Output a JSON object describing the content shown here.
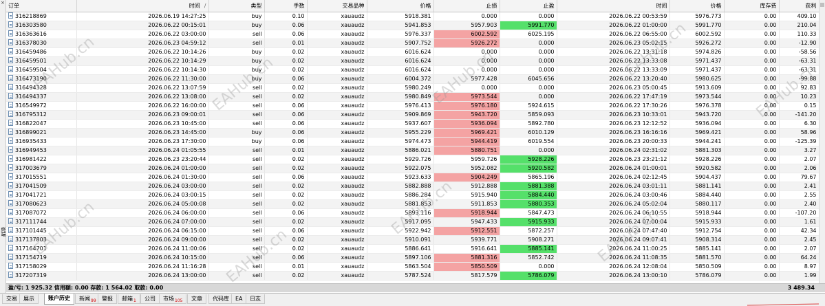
{
  "columns": [
    {
      "key": "order",
      "label": "订单"
    },
    {
      "key": "open_time",
      "label": "时间"
    },
    {
      "key": "type",
      "label": "类型"
    },
    {
      "key": "lots",
      "label": "手数"
    },
    {
      "key": "symbol",
      "label": "交易品种"
    },
    {
      "key": "open_price",
      "label": "价格"
    },
    {
      "key": "sl",
      "label": "止损"
    },
    {
      "key": "tp",
      "label": "止盈"
    },
    {
      "key": "close_time",
      "label": "时间"
    },
    {
      "key": "close_price",
      "label": "价格"
    },
    {
      "key": "swap",
      "label": "库存费"
    },
    {
      "key": "profit",
      "label": "获利"
    }
  ],
  "sort_indicator": "/",
  "rows": [
    {
      "order": "316218869",
      "open_time": "2026.06.19 14:27:25",
      "type": "buy",
      "lots": "0.10",
      "symbol": "xauaudz",
      "open_price": "5918.381",
      "sl": "0.000",
      "tp": "0.000",
      "close_time": "2026.06.22 00:53:59",
      "close_price": "5976.773",
      "swap": "0.00",
      "profit": "409.10",
      "sl_hl": "",
      "tp_hl": ""
    },
    {
      "order": "316303580",
      "open_time": "2026.06.22 00:15:01",
      "type": "buy",
      "lots": "0.06",
      "symbol": "xauaudz",
      "open_price": "5941.853",
      "sl": "5957.903",
      "tp": "5991.770",
      "close_time": "2026.06.22 01:00:00",
      "close_price": "5991.770",
      "swap": "0.00",
      "profit": "210.04",
      "sl_hl": "",
      "tp_hl": "green"
    },
    {
      "order": "316363616",
      "open_time": "2026.06.22 03:00:00",
      "type": "sell",
      "lots": "0.06",
      "symbol": "xauaudz",
      "open_price": "5976.337",
      "sl": "6002.592",
      "tp": "6025.195",
      "close_time": "2026.06.22 06:55:00",
      "close_price": "6002.592",
      "swap": "0.00",
      "profit": "110.33",
      "sl_hl": "red",
      "tp_hl": ""
    },
    {
      "order": "316378030",
      "open_time": "2026.06.23 04:59:12",
      "type": "sell",
      "lots": "0.01",
      "symbol": "xauaudz",
      "open_price": "5907.752",
      "sl": "5926.272",
      "tp": "0.000",
      "close_time": "2026.06.23 05:02:15",
      "close_price": "5926.272",
      "swap": "0.00",
      "profit": "-12.90",
      "sl_hl": "red",
      "tp_hl": ""
    },
    {
      "order": "316459486",
      "open_time": "2026.06.22 10:14:26",
      "type": "buy",
      "lots": "0.02",
      "symbol": "xauaudz",
      "open_price": "6016.624",
      "sl": "0.000",
      "tp": "0.000",
      "close_time": "2026.06.22 13:31:18",
      "close_price": "5974.826",
      "swap": "0.00",
      "profit": "-58.56",
      "sl_hl": "",
      "tp_hl": ""
    },
    {
      "order": "316459501",
      "open_time": "2026.06.22 10:14:29",
      "type": "buy",
      "lots": "0.02",
      "symbol": "xauaudz",
      "open_price": "6016.624",
      "sl": "0.000",
      "tp": "0.000",
      "close_time": "2026.06.22 13:33:08",
      "close_price": "5971.437",
      "swap": "0.00",
      "profit": "-63.31",
      "sl_hl": "",
      "tp_hl": ""
    },
    {
      "order": "316459504",
      "open_time": "2026.06.22 10:14:30",
      "type": "buy",
      "lots": "0.02",
      "symbol": "xauaudz",
      "open_price": "6016.624",
      "sl": "0.000",
      "tp": "0.000",
      "close_time": "2026.06.22 13:33:09",
      "close_price": "5971.437",
      "swap": "0.00",
      "profit": "-63.31",
      "sl_hl": "",
      "tp_hl": ""
    },
    {
      "order": "316473190",
      "open_time": "2026.06.22 11:30:00",
      "type": "buy",
      "lots": "0.06",
      "symbol": "xauaudz",
      "open_price": "6004.372",
      "sl": "5977.428",
      "tp": "6045.656",
      "close_time": "2026.06.22 13:20:40",
      "close_price": "5980.625",
      "swap": "0.00",
      "profit": "-99.88",
      "sl_hl": "",
      "tp_hl": ""
    },
    {
      "order": "316494328",
      "open_time": "2026.06.22 13:07:59",
      "type": "sell",
      "lots": "0.02",
      "symbol": "xauaudz",
      "open_price": "5980.249",
      "sl": "0.000",
      "tp": "0.000",
      "close_time": "2026.06.23 05:00:45",
      "close_price": "5913.609",
      "swap": "0.00",
      "profit": "92.83",
      "sl_hl": "",
      "tp_hl": ""
    },
    {
      "order": "316494337",
      "open_time": "2026.06.22 13:08:00",
      "type": "sell",
      "lots": "0.02",
      "symbol": "xauaudz",
      "open_price": "5980.849",
      "sl": "5973.544",
      "tp": "0.000",
      "close_time": "2026.06.22 17:47:19",
      "close_price": "5973.544",
      "swap": "0.00",
      "profit": "10.23",
      "sl_hl": "red",
      "tp_hl": ""
    },
    {
      "order": "316549972",
      "open_time": "2026.06.22 16:00:00",
      "type": "sell",
      "lots": "0.06",
      "symbol": "xauaudz",
      "open_price": "5976.413",
      "sl": "5976.180",
      "tp": "5924.615",
      "close_time": "2026.06.22 17:30:26",
      "close_price": "5976.378",
      "swap": "0.00",
      "profit": "0.15",
      "sl_hl": "red",
      "tp_hl": ""
    },
    {
      "order": "316795312",
      "open_time": "2026.06.23 09:00:01",
      "type": "sell",
      "lots": "0.06",
      "symbol": "xauaudz",
      "open_price": "5909.869",
      "sl": "5943.720",
      "tp": "5859.093",
      "close_time": "2026.06.23 10:33:01",
      "close_price": "5943.720",
      "swap": "0.00",
      "profit": "-141.20",
      "sl_hl": "red",
      "tp_hl": ""
    },
    {
      "order": "316822047",
      "open_time": "2026.06.23 10:45:00",
      "type": "sell",
      "lots": "0.06",
      "symbol": "xauaudz",
      "open_price": "5937.607",
      "sl": "5936.094",
      "tp": "5892.780",
      "close_time": "2026.06.23 12:12:52",
      "close_price": "5936.094",
      "swap": "0.00",
      "profit": "6.30",
      "sl_hl": "red",
      "tp_hl": ""
    },
    {
      "order": "316899021",
      "open_time": "2026.06.23 14:45:00",
      "type": "buy",
      "lots": "0.06",
      "symbol": "xauaudz",
      "open_price": "5955.229",
      "sl": "5969.421",
      "tp": "6010.129",
      "close_time": "2026.06.23 16:16:16",
      "close_price": "5969.421",
      "swap": "0.00",
      "profit": "58.96",
      "sl_hl": "red",
      "tp_hl": ""
    },
    {
      "order": "316935433",
      "open_time": "2026.06.23 17:30:00",
      "type": "buy",
      "lots": "0.06",
      "symbol": "xauaudz",
      "open_price": "5974.473",
      "sl": "5944.419",
      "tp": "6019.554",
      "close_time": "2026.06.23 20:00:33",
      "close_price": "5944.241",
      "swap": "0.00",
      "profit": "-125.39",
      "sl_hl": "red",
      "tp_hl": ""
    },
    {
      "order": "316949453",
      "open_time": "2026.06.24 01:05:55",
      "type": "sell",
      "lots": "0.01",
      "symbol": "xauaudz",
      "open_price": "5886.021",
      "sl": "5880.751",
      "tp": "0.000",
      "close_time": "2026.06.24 02:31:02",
      "close_price": "5881.303",
      "swap": "0.00",
      "profit": "3.27",
      "sl_hl": "red",
      "tp_hl": ""
    },
    {
      "order": "316981422",
      "open_time": "2026.06.23 23:20:44",
      "type": "sell",
      "lots": "0.02",
      "symbol": "xauaudz",
      "open_price": "5929.726",
      "sl": "5959.726",
      "tp": "5928.226",
      "close_time": "2026.06.23 23:21:12",
      "close_price": "5928.226",
      "swap": "0.00",
      "profit": "2.07",
      "sl_hl": "",
      "tp_hl": "green"
    },
    {
      "order": "317003679",
      "open_time": "2026.06.24 01:00:00",
      "type": "sell",
      "lots": "0.02",
      "symbol": "xauaudz",
      "open_price": "5922.075",
      "sl": "5952.082",
      "tp": "5920.582",
      "close_time": "2026.06.24 01:00:01",
      "close_price": "5920.582",
      "swap": "0.00",
      "profit": "2.06",
      "sl_hl": "",
      "tp_hl": "green"
    },
    {
      "order": "317015551",
      "open_time": "2026.06.24 01:30:00",
      "type": "sell",
      "lots": "0.06",
      "symbol": "xauaudz",
      "open_price": "5923.633",
      "sl": "5904.249",
      "tp": "5865.196",
      "close_time": "2026.06.24 02:12:45",
      "close_price": "5904.437",
      "swap": "0.00",
      "profit": "79.67",
      "sl_hl": "red",
      "tp_hl": ""
    },
    {
      "order": "317041509",
      "open_time": "2026.06.24 03:00:00",
      "type": "sell",
      "lots": "0.02",
      "symbol": "xauaudz",
      "open_price": "5882.888",
      "sl": "5912.888",
      "tp": "5881.388",
      "close_time": "2026.06.24 03:01:11",
      "close_price": "5881.141",
      "swap": "0.00",
      "profit": "2.41",
      "sl_hl": "",
      "tp_hl": "green"
    },
    {
      "order": "317041721",
      "open_time": "2026.06.24 03:00:15",
      "type": "sell",
      "lots": "0.02",
      "symbol": "xauaudz",
      "open_price": "5886.284",
      "sl": "5915.940",
      "tp": "5884.440",
      "close_time": "2026.06.24 03:00:46",
      "close_price": "5884.440",
      "swap": "0.00",
      "profit": "2.55",
      "sl_hl": "",
      "tp_hl": "green"
    },
    {
      "order": "317080623",
      "open_time": "2026.06.24 05:00:08",
      "type": "sell",
      "lots": "0.02",
      "symbol": "xauaudz",
      "open_price": "5881.853",
      "sl": "5911.853",
      "tp": "5880.353",
      "close_time": "2026.06.24 05:02:04",
      "close_price": "5880.117",
      "swap": "0.00",
      "profit": "2.40",
      "sl_hl": "",
      "tp_hl": "green"
    },
    {
      "order": "317087072",
      "open_time": "2026.06.24 06:00:00",
      "type": "sell",
      "lots": "0.06",
      "symbol": "xauaudz",
      "open_price": "5893.116",
      "sl": "5918.944",
      "tp": "5847.473",
      "close_time": "2026.06.24 06:10:55",
      "close_price": "5918.944",
      "swap": "0.00",
      "profit": "-107.20",
      "sl_hl": "red",
      "tp_hl": ""
    },
    {
      "order": "317111744",
      "open_time": "2026.06.24 07:00:00",
      "type": "sell",
      "lots": "0.02",
      "symbol": "xauaudz",
      "open_price": "5917.095",
      "sl": "5947.433",
      "tp": "5915.933",
      "close_time": "2026.06.24 07:00:04",
      "close_price": "5915.933",
      "swap": "0.00",
      "profit": "1.61",
      "sl_hl": "",
      "tp_hl": "green"
    },
    {
      "order": "317101445",
      "open_time": "2026.06.24 06:15:00",
      "type": "sell",
      "lots": "0.06",
      "symbol": "xauaudz",
      "open_price": "5922.942",
      "sl": "5912.551",
      "tp": "5872.257",
      "close_time": "2026.06.24 07:47:40",
      "close_price": "5912.754",
      "swap": "0.00",
      "profit": "42.34",
      "sl_hl": "red",
      "tp_hl": ""
    },
    {
      "order": "317137803",
      "open_time": "2026.06.24 09:00:00",
      "type": "sell",
      "lots": "0.02",
      "symbol": "xauaudz",
      "open_price": "5910.091",
      "sl": "5939.771",
      "tp": "5908.271",
      "close_time": "2026.06.24 09:07:41",
      "close_price": "5908.314",
      "swap": "0.00",
      "profit": "2.45",
      "sl_hl": "",
      "tp_hl": ""
    },
    {
      "order": "317164701",
      "open_time": "2026.06.24 11:00:06",
      "type": "sell",
      "lots": "0.02",
      "symbol": "xauaudz",
      "open_price": "5886.641",
      "sl": "5916.641",
      "tp": "5885.141",
      "close_time": "2026.06.24 11:00:25",
      "close_price": "5885.141",
      "swap": "0.00",
      "profit": "2.07",
      "sl_hl": "",
      "tp_hl": "green"
    },
    {
      "order": "317154719",
      "open_time": "2026.06.24 10:15:00",
      "type": "sell",
      "lots": "0.06",
      "symbol": "xauaudz",
      "open_price": "5897.106",
      "sl": "5881.316",
      "tp": "5852.742",
      "close_time": "2026.06.24 11:08:35",
      "close_price": "5881.570",
      "swap": "0.00",
      "profit": "64.24",
      "sl_hl": "red",
      "tp_hl": ""
    },
    {
      "order": "317158029",
      "open_time": "2026.06.24 11:16:28",
      "type": "sell",
      "lots": "0.01",
      "symbol": "xauaudz",
      "open_price": "5863.504",
      "sl": "5850.509",
      "tp": "0.000",
      "close_time": "2026.06.24 12:08:04",
      "close_price": "5850.509",
      "swap": "0.00",
      "profit": "8.97",
      "sl_hl": "red",
      "tp_hl": ""
    },
    {
      "order": "317207319",
      "open_time": "2026.06.24 13:00:00",
      "type": "sell",
      "lots": "0.02",
      "symbol": "xauaudz",
      "open_price": "5787.524",
      "sl": "5817.579",
      "tp": "5786.079",
      "close_time": "2026.06.24 13:00:10",
      "close_price": "5786.079",
      "swap": "0.00",
      "profit": "1.99",
      "sl_hl": "",
      "tp_hl": "green"
    }
  ],
  "summary": {
    "text": "盈/亏: 1 925.32  信用额: 0.00  存款: 1 564.02  取款: 0.00",
    "total": "3 489.34"
  },
  "side_panel": {
    "close_glyph": "×",
    "label": "终端"
  },
  "tabs": [
    {
      "label": "交易",
      "badge": "",
      "active": false
    },
    {
      "label": "展示",
      "badge": "",
      "active": false
    },
    {
      "label": "账户历史",
      "badge": "",
      "active": true
    },
    {
      "label": "新闻",
      "badge": "99",
      "active": false
    },
    {
      "label": "警报",
      "badge": "",
      "active": false
    },
    {
      "label": "邮箱",
      "badge": "1",
      "active": false
    },
    {
      "label": "公司",
      "badge": "",
      "active": false
    },
    {
      "label": "市场",
      "badge": "105",
      "active": false
    },
    {
      "label": "文章",
      "badge": "",
      "active": false
    },
    {
      "label": "代码库",
      "badge": "",
      "active": false
    },
    {
      "label": "EA",
      "badge": "",
      "active": false
    },
    {
      "label": "日志",
      "badge": "",
      "active": false
    }
  ],
  "watermark_text": "EAHub.cn",
  "colors": {
    "sl_highlight": "#f4a3a3",
    "tp_highlight": "#55e06a",
    "summary_bar": "#d8d8d8",
    "badge": "#d00000"
  },
  "icons": {
    "row": "document-icon",
    "close": "close-icon"
  }
}
